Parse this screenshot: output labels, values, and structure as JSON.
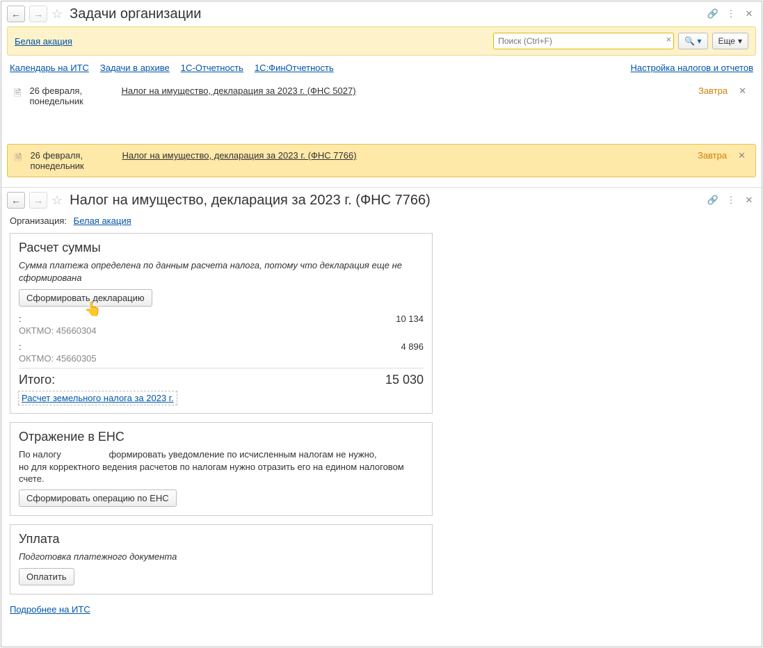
{
  "header": {
    "title": "Задачи организации"
  },
  "search": {
    "placeholder": "Поиск (Ctrl+F)"
  },
  "buttons": {
    "more": "Еще"
  },
  "org": {
    "name": "Белая акация"
  },
  "linkbar": {
    "items": [
      "Календарь на ИТС",
      "Задачи в архиве",
      "1С-Отчетность",
      "1С:ФинОтчетность"
    ],
    "right": "Настройка налогов и отчетов"
  },
  "tasks": [
    {
      "date_line1": "26 февраля,",
      "date_line2": "понедельник",
      "title": "Налог на имущество, декларация за 2023 г. (ФНС 5027)",
      "status": "Завтра"
    },
    {
      "date_line1": "26 февраля,",
      "date_line2": "понедельник",
      "title": "Налог на имущество, декларация за 2023 г. (ФНС 7766)",
      "status": "Завтра"
    }
  ],
  "detail": {
    "title": "Налог на имущество, декларация за 2023 г. (ФНС 7766)",
    "org_label": "Организация:",
    "org_name": "Белая акация"
  },
  "calc": {
    "heading": "Расчет суммы",
    "desc": "Сумма платежа определена по данным расчета налога, потому что декларация еще не сформирована",
    "btn": "Сформировать декларацию",
    "rows": [
      {
        "label": ":",
        "value": "10 134",
        "oktmo": "ОКТМО: 45660304"
      },
      {
        "label": ":",
        "value": "4 896",
        "oktmo": "ОКТМО: 45660305"
      }
    ],
    "total_label": "Итого:",
    "total_value": "15 030",
    "link": "Расчет земельного налога за 2023 г."
  },
  "ens": {
    "heading": "Отражение в ЕНС",
    "line_prefix": "По налогу",
    "line_rest": "формировать уведомление по исчисленным налогам не нужно,",
    "line2": "но для корректного ведения расчетов по налогам нужно отразить его на едином налоговом счете.",
    "btn": "Сформировать операцию по ЕНС"
  },
  "pay": {
    "heading": "Уплата",
    "desc": "Подготовка платежного документа",
    "btn": "Оплатить"
  },
  "footer": {
    "link": "Подробнее на ИТС"
  }
}
